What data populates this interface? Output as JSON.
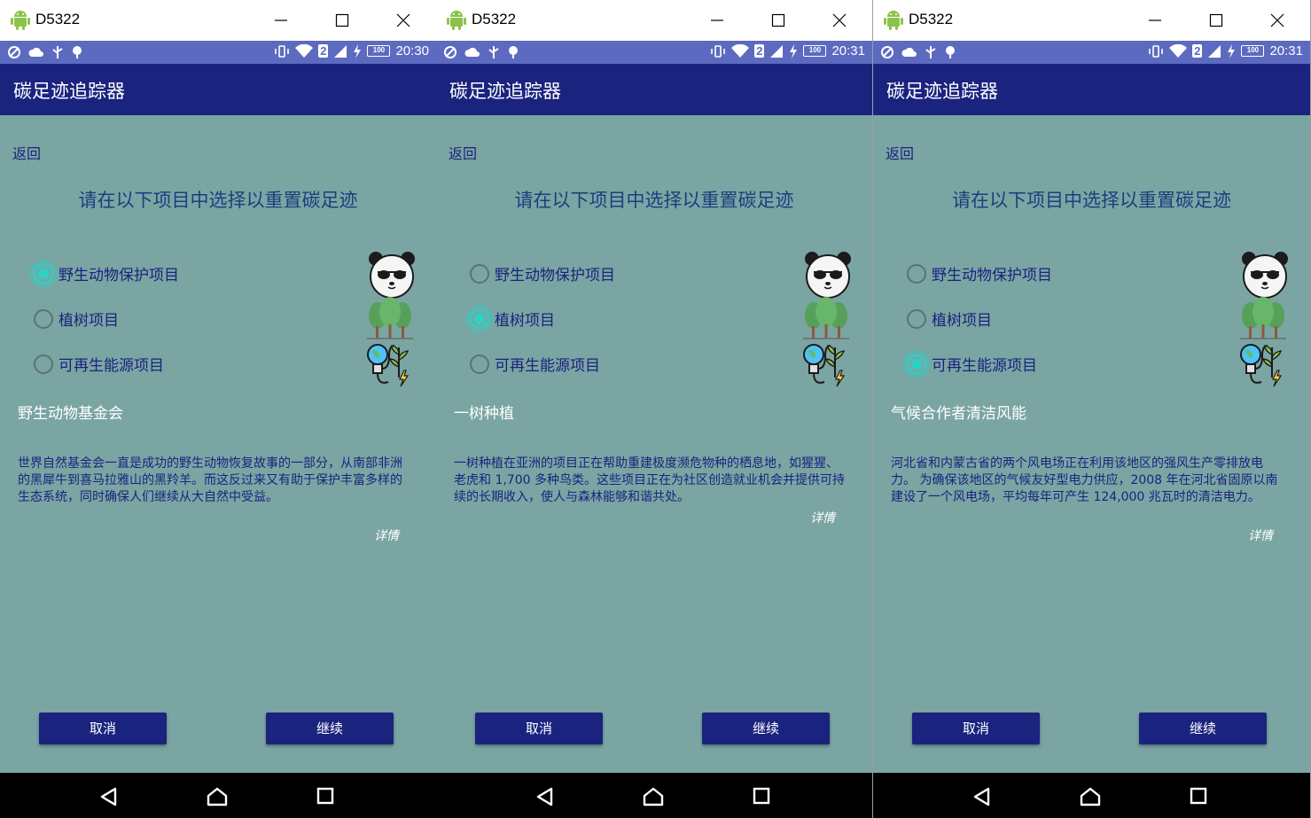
{
  "screens": [
    {
      "window_title": "D5322",
      "status": {
        "time": "20:30",
        "battery": "100",
        "sim": "2"
      },
      "app_title": "碳足迹追踪器",
      "back_label": "返回",
      "prompt": "请在以下项目中选择以重置碳足迹",
      "options": [
        {
          "label": "野生动物保护项目",
          "checked": true
        },
        {
          "label": "植树项目",
          "checked": false
        },
        {
          "label": "可再生能源项目",
          "checked": false
        }
      ],
      "fund_name": "野生动物基金会",
      "description": "世界自然基金会一直是成功的野生动物恢复故事的一部分，从南部非洲的黑犀牛到喜马拉雅山的黑羚羊。而这反过来又有助于保护丰富多样的生态系统，同时确保人们继续从大自然中受益。",
      "details_label": "详情",
      "cancel_label": "取消",
      "continue_label": "继续"
    },
    {
      "window_title": "D5322",
      "status": {
        "time": "20:31",
        "battery": "100",
        "sim": "2"
      },
      "app_title": "碳足迹追踪器",
      "back_label": "返回",
      "prompt": "请在以下项目中选择以重置碳足迹",
      "options": [
        {
          "label": "野生动物保护项目",
          "checked": false
        },
        {
          "label": "植树项目",
          "checked": true
        },
        {
          "label": "可再生能源项目",
          "checked": false
        }
      ],
      "fund_name": "一树种植",
      "description": "一树种植在亚洲的项目正在帮助重建极度濒危物种的栖息地，如猩猩、老虎和 1,700 多种鸟类。这些项目正在为社区创造就业机会并提供可持续的长期收入，使人与森林能够和谐共处。",
      "details_label": "详情",
      "cancel_label": "取消",
      "continue_label": "继续"
    },
    {
      "window_title": "D5322",
      "status": {
        "time": "20:31",
        "battery": "100",
        "sim": "2"
      },
      "app_title": "碳足迹追踪器",
      "back_label": "返回",
      "prompt": "请在以下项目中选择以重置碳足迹",
      "options": [
        {
          "label": "野生动物保护项目",
          "checked": false
        },
        {
          "label": "植树项目",
          "checked": false
        },
        {
          "label": "可再生能源项目",
          "checked": true
        }
      ],
      "fund_name": "气候合作者清洁风能",
      "description": "河北省和内蒙古省的两个风电场正在利用该地区的强风生产零排放电力。 为确保该地区的气候友好型电力供应，2008 年在河北省固原以南建设了一个风电场，平均每年可产生 124,000 兆瓦时的清洁电力。",
      "details_label": "详情",
      "cancel_label": "取消",
      "continue_label": "继续"
    }
  ],
  "icons": {
    "option_icons": [
      "panda-icon",
      "trees-icon",
      "renewable-energy-icon"
    ],
    "window_app_icon": "android-icon",
    "nav": [
      "back-triangle-icon",
      "home-icon",
      "recent-apps-icon"
    ]
  },
  "colors": {
    "window_bg": "#ffffff",
    "status_bar": "#5c6bc0",
    "app_bar": "#1a237e",
    "content_bg": "#7aa5a3",
    "radio_checked": "#2bd3c6",
    "button": "#1a237e"
  }
}
